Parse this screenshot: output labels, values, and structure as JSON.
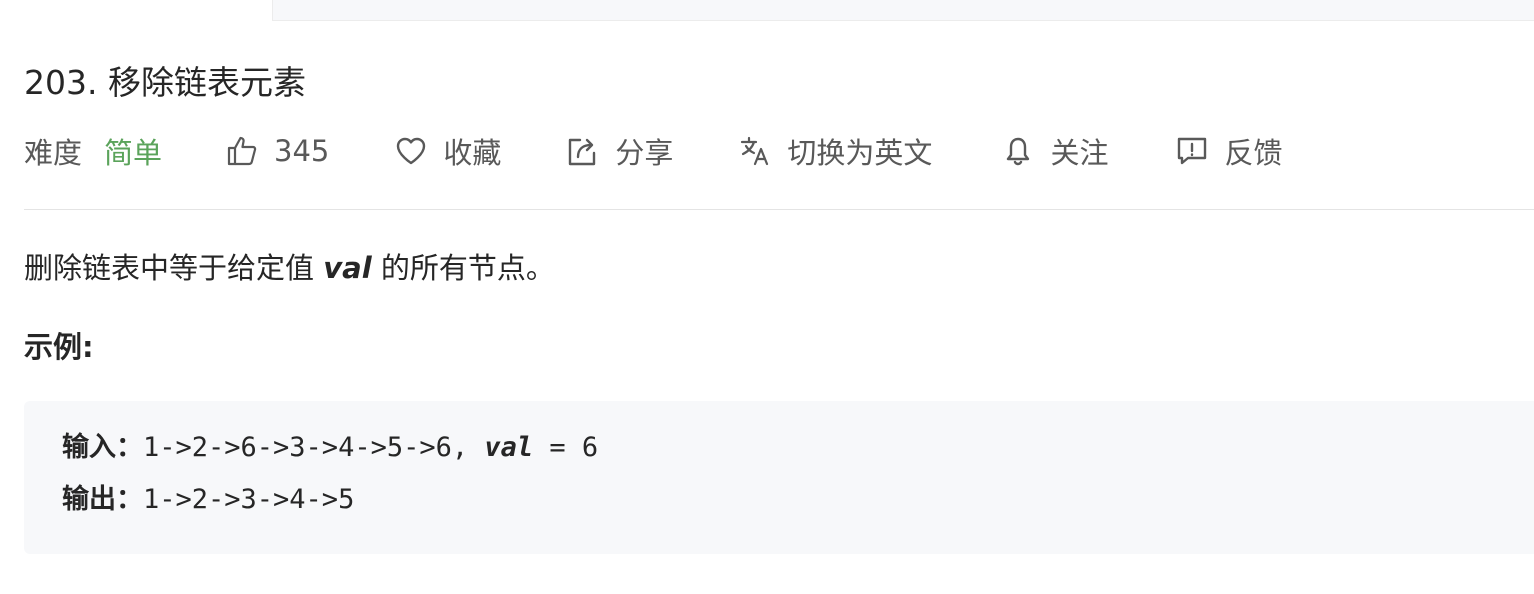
{
  "problem": {
    "title": "203. 移除链表元素"
  },
  "toolbar": {
    "difficulty_label": "难度",
    "difficulty_value": "简单",
    "likes": "345",
    "favorite_label": "收藏",
    "share_label": "分享",
    "switch_lang_label": "切换为英文",
    "follow_label": "关注",
    "feedback_label": "反馈"
  },
  "description": {
    "before": "删除链表中等于给定值 ",
    "keyword": "val",
    "after": " 的所有节点。"
  },
  "example": {
    "label": "示例:",
    "input_label": "输入：",
    "input_list": "1->2->6->3->4->5->6, ",
    "input_keyword": "val",
    "input_rest": " = 6",
    "output_label": "输出：",
    "output_value": "1->2->3->4->5"
  },
  "colors": {
    "difficulty_easy": "#5ba35b",
    "icon": "#595959",
    "code_background": "#f7f8fa"
  }
}
